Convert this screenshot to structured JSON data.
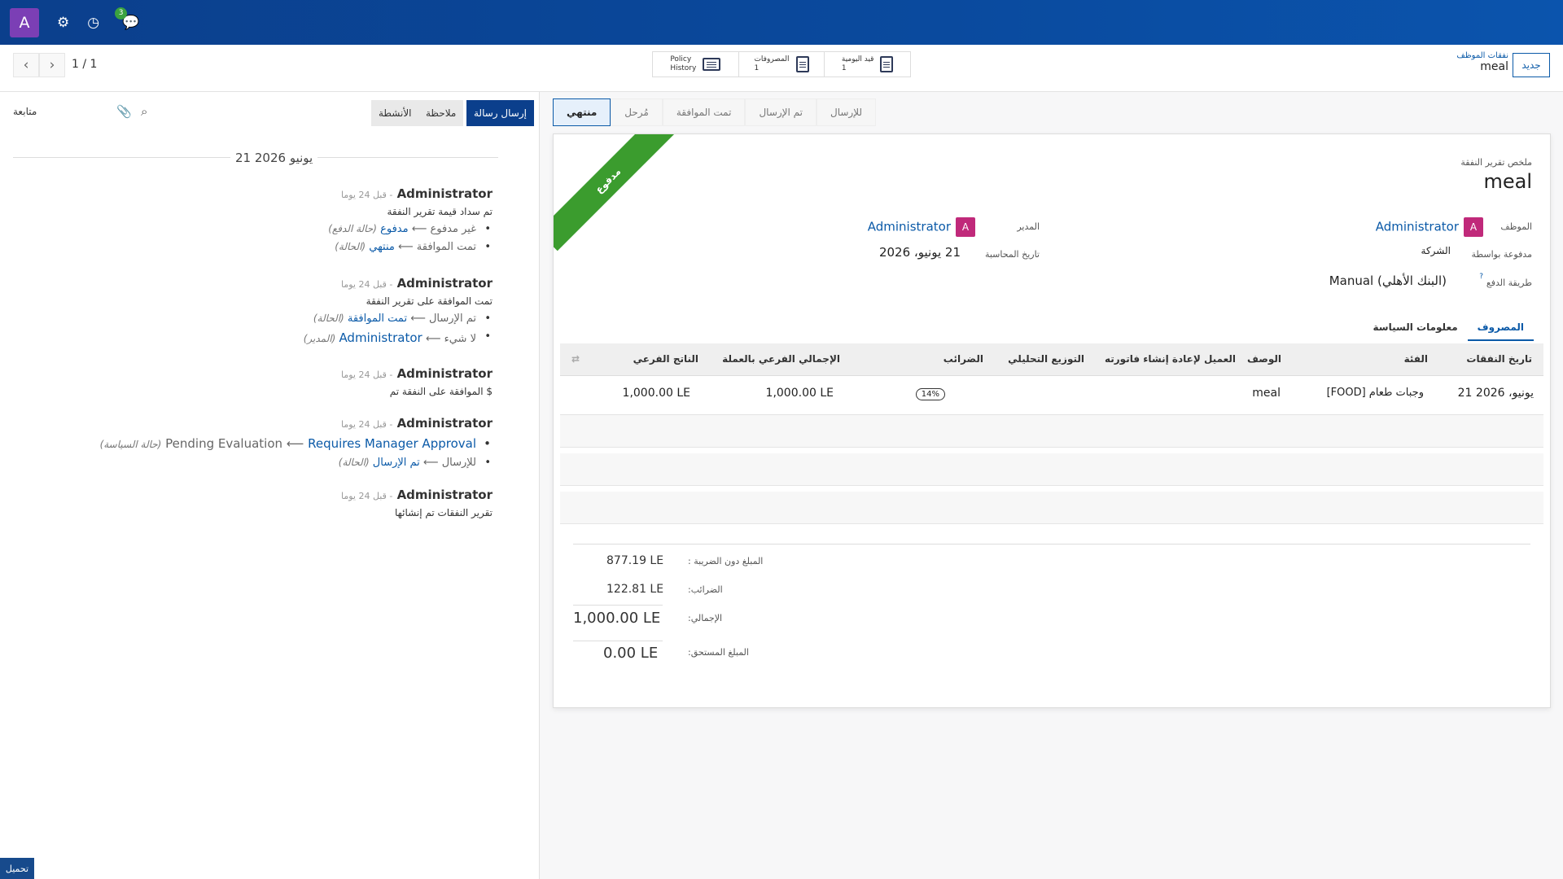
{
  "topbar": {
    "avatar": "A",
    "chat_count": "3"
  },
  "control": {
    "pager": "1 / 1",
    "smart_buttons": {
      "journal_label": "قيد اليومية",
      "journal_count": "1",
      "expenses_label": "المصروفات",
      "expenses_count": "1",
      "policy_line1": "Policy",
      "policy_line2": "History"
    },
    "breadcrumb_parent": "نفقات الموظف",
    "breadcrumb_current": "meal",
    "new_button": "جديد"
  },
  "chatter": {
    "send_message": "إرسال رسالة",
    "log_note": "ملاحظة",
    "activities": "الأنشطة",
    "follow": "متابعة",
    "date_separator": "21 يونيو 2026",
    "messages": [
      {
        "author": "Administrator",
        "ago": "- قبل 24 يوما",
        "body": "تم سداد قيمة تقرير النفقة",
        "tracks": [
          {
            "old": "غير مدفوع",
            "new": "مدفوع",
            "field": "(حالة الدفع)"
          },
          {
            "old": "تمت الموافقة",
            "new": "منتهي",
            "field": "(الحالة)"
          }
        ]
      },
      {
        "author": "Administrator",
        "ago": "- قبل 24 يوما",
        "body": "تمت الموافقة على تقرير النفقة",
        "tracks": [
          {
            "old": "تم الإرسال",
            "new": "تمت الموافقة",
            "field": "(الحالة)"
          },
          {
            "old": "لا شيء",
            "new": "Administrator",
            "field": "(المدير)"
          }
        ]
      },
      {
        "author": "Administrator",
        "ago": "- قبل 24 يوما",
        "body": "$ الموافقة على النفقة تم",
        "tracks": []
      },
      {
        "author": "Administrator",
        "ago": "- قبل 24 يوما",
        "body": "",
        "tracks": [
          {
            "old": "Pending Evaluation",
            "new": "Requires Manager Approval",
            "field": "(حالة السياسة)"
          },
          {
            "old": "للإرسال",
            "new": "تم الإرسال",
            "field": "(الحالة)"
          }
        ]
      },
      {
        "author": "Administrator",
        "ago": "- قبل 24 يوما",
        "body": "تقرير النفقات تم إنشائها",
        "tracks": []
      }
    ],
    "upload": "تحميل"
  },
  "statusbar": [
    "للإرسال",
    "تم الإرسال",
    "تمت الموافقة",
    "مُرحل",
    "منتهي"
  ],
  "statusbar_active": "منتهي",
  "form": {
    "ribbon": "مدفوع",
    "summary_label": "ملخص تقرير النفقة",
    "title": "meal",
    "employee_label": "الموظف",
    "employee": "Administrator",
    "manager_label": "المدير",
    "manager": "Administrator",
    "paid_by_label": "مدفوعة بواسطة",
    "paid_by": "الشركة",
    "accounting_date_label": "تاريخ المحاسبة",
    "accounting_date": "21 يونيو، 2026",
    "payment_method_label": "طريقة الدفع",
    "payment_method": "Manual (البنك الأهلي)",
    "tabs": [
      "المصروف",
      "معلومات السياسة"
    ],
    "columns": [
      "تاريخ النفقات",
      "الفئة",
      "الوصف",
      "العميل لإعادة إنشاء فاتورته",
      "التوزيع التحليلي",
      "الضرائب",
      "الإجمالي الفرعي بالعملة",
      "الناتج الفرعي"
    ],
    "line": {
      "date": "21 يونيو، 2026",
      "category": "[FOOD] وجبات طعام",
      "description": "meal",
      "tax": "14%",
      "subtotal_currency": "1,000.00 LE",
      "subtotal": "1,000.00 LE"
    },
    "totals": {
      "untaxed_label": "المبلغ دون الضريبة :",
      "untaxed": "877.19 LE",
      "taxes_label": "الضرائب:",
      "taxes": "122.81 LE",
      "total_label": "الإجمالي:",
      "total": "1,000.00 LE",
      "due_label": "المبلغ المستحق:",
      "due": "0.00 LE"
    }
  }
}
